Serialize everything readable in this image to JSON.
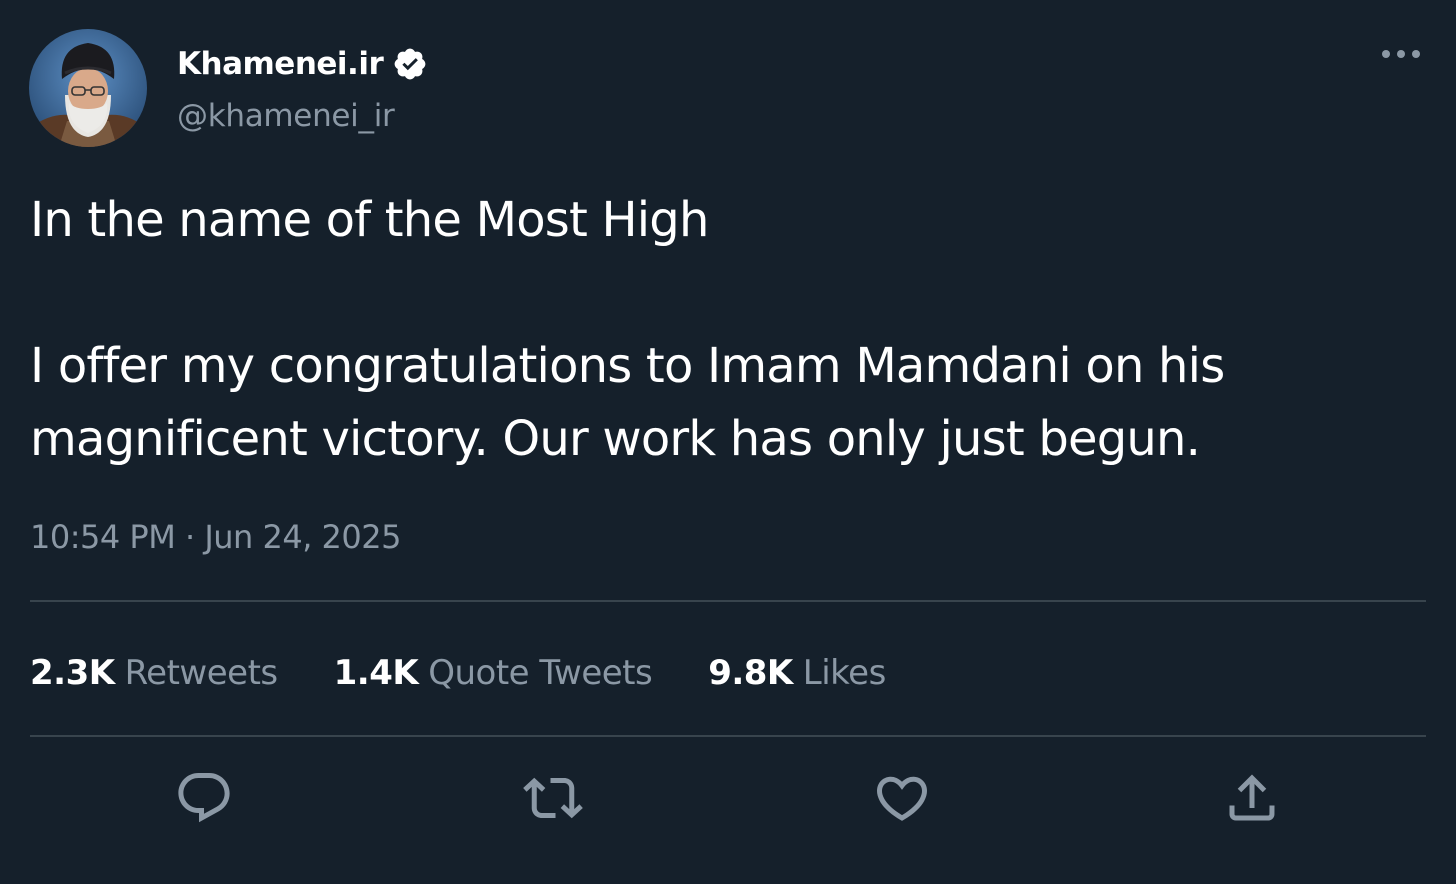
{
  "author": {
    "display_name": "Khamenei.ir",
    "handle": "@khamenei_ir",
    "verified": true,
    "avatar_icon": "profile-photo"
  },
  "tweet": {
    "lines": [
      "In the name of the Most High",
      "I offer my congratulations to Imam Mamdani on his",
      "magnificent victory. Our work has only just begun."
    ],
    "timestamp": "10:54 PM · Jun 24, 2025"
  },
  "stats": [
    {
      "count": "2.3K",
      "label": "Retweets"
    },
    {
      "count": "1.4K",
      "label": "Quote Tweets"
    },
    {
      "count": "9.8K",
      "label": "Likes"
    }
  ],
  "actions": [
    "reply-icon",
    "retweet-icon",
    "like-icon",
    "share-icon"
  ],
  "colors": {
    "background": "#15202b",
    "text": "#ffffff",
    "secondary_text": "#8b98a5",
    "divider": "#38444d"
  }
}
